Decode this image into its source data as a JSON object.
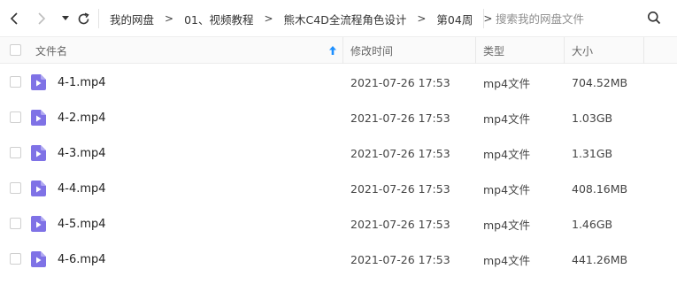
{
  "toolbar": {
    "back_icon": "chevron-left-icon",
    "forward_icon": "chevron-right-icon",
    "history_dropdown_icon": "caret-down-icon",
    "refresh_icon": "refresh-icon"
  },
  "breadcrumb": {
    "items": [
      "我的网盘",
      "01、视频教程",
      "熊木C4D全流程角色设计",
      "第04周"
    ],
    "separator": ">"
  },
  "search": {
    "placeholder": "搜索我的网盘文件",
    "icon": "search-icon"
  },
  "table": {
    "columns": {
      "name": "文件名",
      "modified": "修改时间",
      "type": "类型",
      "size": "大小"
    },
    "sort_indicator": "arrow-up-icon",
    "rows": [
      {
        "name": "4-1.mp4",
        "modified": "2021-07-26 17:53",
        "type": "mp4文件",
        "size": "704.52MB"
      },
      {
        "name": "4-2.mp4",
        "modified": "2021-07-26 17:53",
        "type": "mp4文件",
        "size": "1.03GB"
      },
      {
        "name": "4-3.mp4",
        "modified": "2021-07-26 17:53",
        "type": "mp4文件",
        "size": "1.31GB"
      },
      {
        "name": "4-4.mp4",
        "modified": "2021-07-26 17:53",
        "type": "mp4文件",
        "size": "408.16MB"
      },
      {
        "name": "4-5.mp4",
        "modified": "2021-07-26 17:53",
        "type": "mp4文件",
        "size": "1.46GB"
      },
      {
        "name": "4-6.mp4",
        "modified": "2021-07-26 17:53",
        "type": "mp4文件",
        "size": "441.26MB"
      }
    ]
  },
  "colors": {
    "video_icon": "#7f72e6",
    "sort_arrow": "#1e90ff",
    "header_bg": "#fafafa"
  }
}
